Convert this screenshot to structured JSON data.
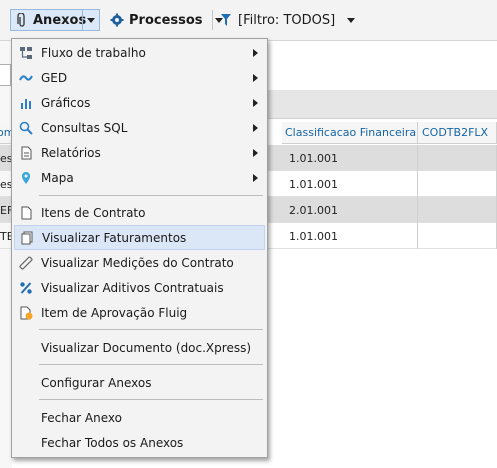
{
  "toolbar": {
    "anexos_label": "Anexos",
    "processos_label": "Processos",
    "filtro_label": "[Filtro: TODOS]"
  },
  "grid": {
    "columns": [
      "Classificacao Financeira",
      "CODTB2FLX"
    ],
    "row_stubs": [
      "es",
      "es",
      "EF",
      "TES"
    ],
    "rows": [
      "1.01.001",
      "1.01.001",
      "2.01.001",
      "1.01.001"
    ],
    "header_stub": "om"
  },
  "menu": {
    "items": [
      {
        "label": "Fluxo de trabalho",
        "icon": "workflow-icon",
        "submenu": true
      },
      {
        "label": "GED",
        "icon": "ged-icon",
        "submenu": true
      },
      {
        "label": "Gráficos",
        "icon": "chart-icon",
        "submenu": true
      },
      {
        "label": "Consultas SQL",
        "icon": "search-icon",
        "submenu": true
      },
      {
        "label": "Relatórios",
        "icon": "report-icon",
        "submenu": true
      },
      {
        "label": "Mapa",
        "icon": "map-pin-icon",
        "submenu": true
      },
      {
        "label": "Itens de Contrato",
        "icon": "document-icon"
      },
      {
        "label": "Visualizar Faturamentos",
        "icon": "invoice-icon",
        "highlighted": true
      },
      {
        "label": "Visualizar Medições do Contrato",
        "icon": "ruler-icon"
      },
      {
        "label": "Visualizar Aditivos Contratuais",
        "icon": "percent-icon"
      },
      {
        "label": "Item de Aprovação Fluig",
        "icon": "approval-icon"
      },
      {
        "label": "Visualizar Documento (doc.Xpress)"
      },
      {
        "label": "Configurar Anexos"
      },
      {
        "label": "Fechar Anexo"
      },
      {
        "label": "Fechar Todos os Anexos"
      }
    ]
  }
}
